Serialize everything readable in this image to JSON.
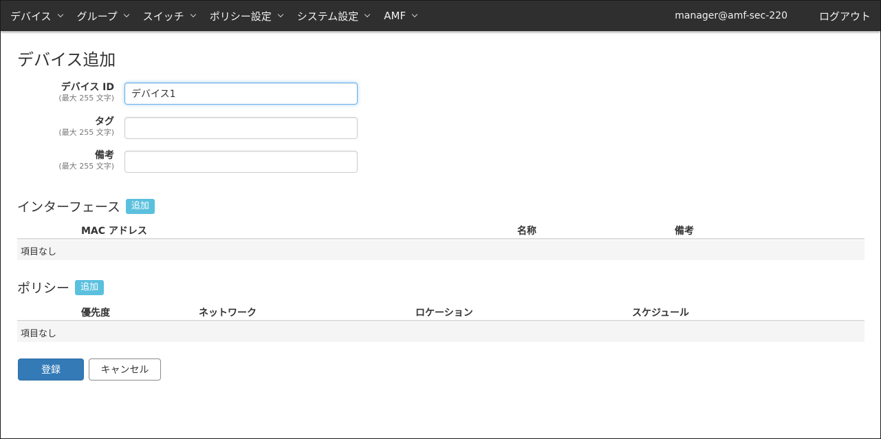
{
  "nav": {
    "menu": [
      {
        "label": "デバイス"
      },
      {
        "label": "グループ"
      },
      {
        "label": "スイッチ"
      },
      {
        "label": "ポリシー設定"
      },
      {
        "label": "システム設定"
      },
      {
        "label": "AMF"
      }
    ],
    "user": "manager@amf-sec-220",
    "logout": "ログアウト"
  },
  "page_title": "デバイス追加",
  "form": {
    "device_id": {
      "label": "デバイス ID",
      "hint": "(最大 255 文字)",
      "value": "デバイス1"
    },
    "tag": {
      "label": "タグ",
      "hint": "(最大 255 文字)",
      "value": ""
    },
    "note": {
      "label": "備考",
      "hint": "(最大 255 文字)",
      "value": ""
    }
  },
  "interfaces": {
    "title": "インターフェース",
    "add_label": "追加",
    "columns": [
      "MAC アドレス",
      "名称",
      "備考"
    ],
    "empty_text": "項目なし"
  },
  "policies": {
    "title": "ポリシー",
    "add_label": "追加",
    "columns": [
      "優先度",
      "ネットワーク",
      "ロケーション",
      "スケジュール"
    ],
    "empty_text": "項目なし"
  },
  "actions": {
    "submit": "登録",
    "cancel": "キャンセル"
  },
  "colors": {
    "navbar_bg": "#2f2f2f",
    "primary": "#337ab7",
    "info": "#5bc0de",
    "focus": "#66afe9"
  }
}
